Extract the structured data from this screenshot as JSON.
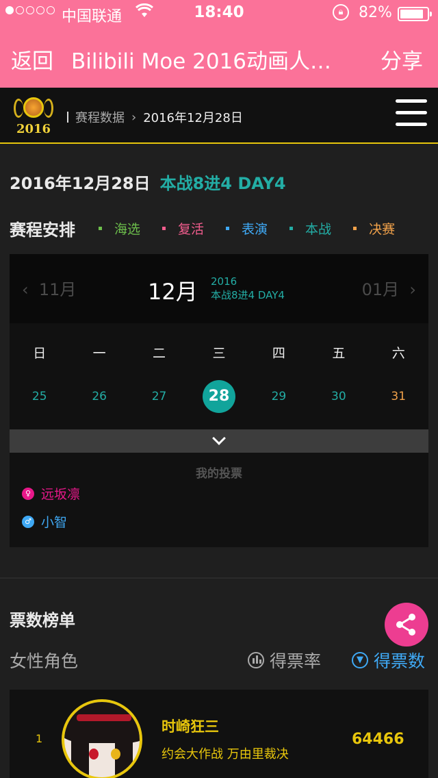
{
  "status_bar": {
    "carrier": "中国联通",
    "time": "18:40",
    "battery": "82%",
    "battery_level": 0.82
  },
  "nav": {
    "back": "返回",
    "title": "Bilibili Moe 2016动画人气角...",
    "share": "分享"
  },
  "header": {
    "logo_year": "2016",
    "breadcrumb_section": "赛程数据",
    "breadcrumb_current": "2016年12月28日"
  },
  "day": {
    "date": "2016年12月28日",
    "round": "本战8进4 DAY4"
  },
  "schedule": {
    "label": "赛程安排",
    "legend": [
      {
        "label": "海选",
        "color": "#6dbf4c"
      },
      {
        "label": "复活",
        "color": "#f25d8e"
      },
      {
        "label": "表演",
        "color": "#3fa9f5"
      },
      {
        "label": "本战",
        "color": "#23ada5"
      },
      {
        "label": "决赛",
        "color": "#f2a24a"
      }
    ]
  },
  "calendar": {
    "prev_month": "11月",
    "month": "12月",
    "year": "2016",
    "round": "本战8进4 DAY4",
    "next_month": "01月",
    "weekdays": [
      "日",
      "一",
      "二",
      "三",
      "四",
      "五",
      "六"
    ],
    "dates": [
      "25",
      "26",
      "27",
      "28",
      "29",
      "30",
      "31"
    ],
    "selected_index": 3
  },
  "my_votes": {
    "title": "我的投票",
    "items": [
      {
        "name": "远坂凛",
        "gender": "female",
        "color": "#e8188a"
      },
      {
        "name": "小智",
        "gender": "male",
        "color": "#3fa9f5"
      }
    ]
  },
  "ranking": {
    "title": "票数榜单",
    "category": "女性角色",
    "tab_rate": "得票率",
    "tab_count": "得票数",
    "rows": [
      {
        "rank": "1",
        "name": "时崎狂三",
        "works": "约会大作战  万由里裁决",
        "votes": "64466"
      }
    ]
  }
}
